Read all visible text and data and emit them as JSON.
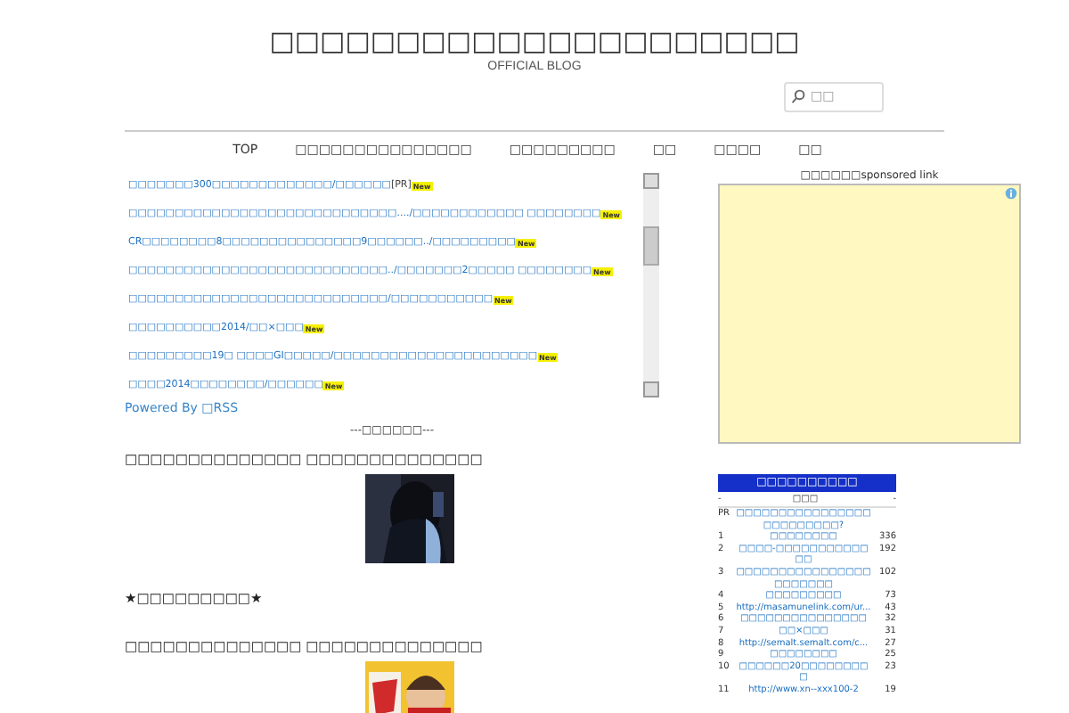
{
  "header": {
    "title": "□□□□□□□□□□□□□□□□□□□□□",
    "subtitle": "OFFICIAL BLOG",
    "search": {
      "placeholder": "□□"
    }
  },
  "nav": [
    "TOP",
    "□□□□□□□□□□□□□□□",
    "□□□□□□□□□",
    "□□",
    "□□□□",
    "□□"
  ],
  "feed": [
    {
      "text": "□□□□□□□300□□□□□□□□□□□□□/□□□□□□",
      "pr": "[PR]",
      "badge": "New"
    },
    {
      "text": "□□□□□□□□□□□□□□□□□□□□□□□□□□□□□..../□□□□□□□□□□□□ □□□□□□□□",
      "badge": "New"
    },
    {
      "text": "CR□□□□□□□□8□□□□□□□□□□□□□□□9□□□□□□../□□□□□□□□□",
      "badge": "New"
    },
    {
      "text": "□□□□□□□□□□□□□□□□□□□□□□□□□□□□../□□□□□□□2□□□□□ □□□□□□□□",
      "badge": "New"
    },
    {
      "text": "□□□□□□□□□□□□□□□□□□□□□□□□□□□□/□□□□□□□□□□□",
      "badge": "New"
    },
    {
      "text": "□□□□□□□□□□2014/□□×□□□",
      "badge": "New"
    },
    {
      "text": "□□□□□□□□□19□ □□□□GI□□□□□/□□□□□□□□□□□□□□□□□□□□□□",
      "badge": "New"
    },
    {
      "text": "□□□□2014□□□□□□□□/□□□□□□",
      "badge": "New"
    }
  ],
  "powered": "Powered By □RSS",
  "separator": "---□□□□□□---",
  "posts": [
    {
      "kind": "article",
      "title": "□□□□□□□□□□□□□□ □□□□□□□□□□□□□□"
    },
    {
      "kind": "heading",
      "title": "★□□□□□□□□□★"
    },
    {
      "kind": "article",
      "title": "□□□□□□□□□□□□□□ □□□□□□□□□□□□□□"
    }
  ],
  "sponsored": "□□□□□□sponsored link",
  "ranking": {
    "title": "□□□□□□□□□□",
    "head": [
      "-",
      "□□□",
      "-"
    ],
    "rows": [
      {
        "rank": "PR",
        "link": "□□□□□□□□□□□□□□□□□□□□□□□□□?",
        "count": ""
      },
      {
        "rank": "1",
        "link": "□□□□□□□□",
        "count": "336"
      },
      {
        "rank": "2",
        "link": "□□□□-□□□□□□□□□□□□□",
        "count": "192"
      },
      {
        "rank": "3",
        "link": "□□□□□□□□□□□□□□□□□□□□□□□",
        "count": "102"
      },
      {
        "rank": "4",
        "link": "□□□□□□□□□",
        "count": "73"
      },
      {
        "rank": "5",
        "link": "http://masamunelink.com/ur...",
        "count": "43"
      },
      {
        "rank": "6",
        "link": "□□□□□□□□□□□□□□□",
        "count": "32"
      },
      {
        "rank": "7",
        "link": "□□×□□□",
        "count": "31"
      },
      {
        "rank": "8",
        "link": "http://semalt.semalt.com/c...",
        "count": "27"
      },
      {
        "rank": "9",
        "link": "□□□□□□□□",
        "count": "25"
      },
      {
        "rank": "10",
        "link": "□□□□□□20□□□□□□□□□",
        "count": "23"
      },
      {
        "rank": "11",
        "link": "http://www.xn--xxx100-2",
        "count": "19"
      }
    ]
  }
}
